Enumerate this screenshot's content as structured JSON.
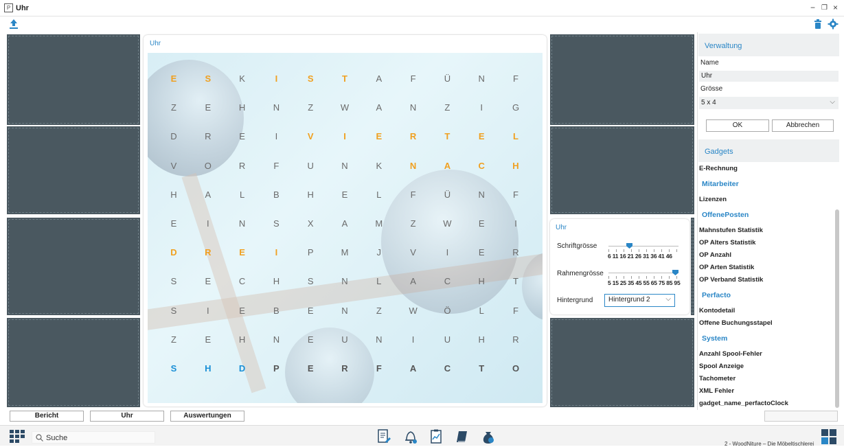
{
  "window": {
    "title": "Uhr",
    "minimize": "−",
    "restore": "❐",
    "close": "×"
  },
  "clock_panel": {
    "title": "Uhr",
    "rows": [
      [
        "E",
        "S",
        "K",
        "I",
        "S",
        "T",
        "A",
        "F",
        "Ü",
        "N",
        "F"
      ],
      [
        "Z",
        "E",
        "H",
        "N",
        "Z",
        "W",
        "A",
        "N",
        "Z",
        "I",
        "G"
      ],
      [
        "D",
        "R",
        "E",
        "I",
        "V",
        "I",
        "E",
        "R",
        "T",
        "E",
        "L"
      ],
      [
        "V",
        "O",
        "R",
        "F",
        "U",
        "N",
        "K",
        "N",
        "A",
        "C",
        "H"
      ],
      [
        "H",
        "A",
        "L",
        "B",
        "H",
        "E",
        "L",
        "F",
        "Ü",
        "N",
        "F"
      ],
      [
        "E",
        "I",
        "N",
        "S",
        "X",
        "A",
        "M",
        "Z",
        "W",
        "E",
        "I"
      ],
      [
        "D",
        "R",
        "E",
        "I",
        "P",
        "M",
        "J",
        "V",
        "I",
        "E",
        "R"
      ],
      [
        "S",
        "E",
        "C",
        "H",
        "S",
        "N",
        "L",
        "A",
        "C",
        "H",
        "T"
      ],
      [
        "S",
        "I",
        "E",
        "B",
        "E",
        "N",
        "Z",
        "W",
        "Ö",
        "L",
        "F"
      ],
      [
        "Z",
        "E",
        "H",
        "N",
        "E",
        "U",
        "N",
        "I",
        "U",
        "H",
        "R"
      ],
      [
        "S",
        "H",
        "D",
        "P",
        "E",
        "R",
        "F",
        "A",
        "C",
        "T",
        "O"
      ]
    ],
    "highlight_orange": [
      [
        0,
        0
      ],
      [
        0,
        1
      ],
      [
        0,
        3
      ],
      [
        0,
        4
      ],
      [
        0,
        5
      ],
      [
        2,
        4
      ],
      [
        2,
        5
      ],
      [
        2,
        6
      ],
      [
        2,
        7
      ],
      [
        2,
        8
      ],
      [
        2,
        9
      ],
      [
        2,
        10
      ],
      [
        3,
        7
      ],
      [
        3,
        8
      ],
      [
        3,
        9
      ],
      [
        3,
        10
      ],
      [
        6,
        0
      ],
      [
        6,
        1
      ],
      [
        6,
        2
      ],
      [
        6,
        3
      ]
    ],
    "highlight_blue": [
      [
        10,
        0
      ],
      [
        10,
        1
      ],
      [
        10,
        2
      ]
    ],
    "highlight_dark": [
      [
        10,
        3
      ],
      [
        10,
        4
      ],
      [
        10,
        5
      ],
      [
        10,
        6
      ],
      [
        10,
        7
      ],
      [
        10,
        8
      ],
      [
        10,
        9
      ],
      [
        10,
        10
      ]
    ]
  },
  "settings_panel": {
    "title": "Uhr",
    "font_size_label": "Schriftgrösse",
    "font_size_ticks": "6 11 16 21 26 31 36 41 46",
    "font_size_level": 0.28,
    "frame_size_label": "Rahmengrösse",
    "frame_size_ticks": "5 15 25 35 45 55 65 75 85 95",
    "frame_size_level": 1.0,
    "background_label": "Hintergrund",
    "background_value": "Hintergrund 2"
  },
  "sidebar": {
    "admin_header": "Verwaltung",
    "name_label": "Name",
    "name_value": "Uhr",
    "size_label": "Grösse",
    "size_value": "5 x 4",
    "ok_label": "OK",
    "cancel_label": "Abbrechen",
    "gadgets_header": "Gadgets",
    "gadgets": [
      {
        "text": "E-Rechnung",
        "kind": "item"
      },
      {
        "text": "Mitarbeiter",
        "kind": "cat"
      },
      {
        "text": "Lizenzen",
        "kind": "item"
      },
      {
        "text": "OffenePosten",
        "kind": "cat"
      },
      {
        "text": "Mahnstufen Statistik",
        "kind": "item"
      },
      {
        "text": "OP Alters Statistik",
        "kind": "item"
      },
      {
        "text": "OP Anzahl",
        "kind": "item"
      },
      {
        "text": "OP Arten Statistik",
        "kind": "item"
      },
      {
        "text": "OP Verband Statistik",
        "kind": "item"
      },
      {
        "text": "Perfacto",
        "kind": "cat"
      },
      {
        "text": "Kontodetail",
        "kind": "item"
      },
      {
        "text": "Offene Buchungsstapel",
        "kind": "item"
      },
      {
        "text": "System",
        "kind": "cat"
      },
      {
        "text": "Anzahl Spool-Fehler",
        "kind": "item"
      },
      {
        "text": "Spool Anzeige",
        "kind": "item"
      },
      {
        "text": "Tachometer",
        "kind": "item"
      },
      {
        "text": "XML Fehler",
        "kind": "item"
      },
      {
        "text": "gadget_name_perfactoClock",
        "kind": "item"
      }
    ]
  },
  "tabs": [
    "Bericht",
    "Uhr",
    "Auswertungen"
  ],
  "taskbar": {
    "search_placeholder": "Suche",
    "status_text": "2 - WoodNiture – Die Möbeltischlerei"
  },
  "colors": {
    "accent": "#2a86c6",
    "highlight": "#f0a020",
    "tile": "#4a5860"
  }
}
